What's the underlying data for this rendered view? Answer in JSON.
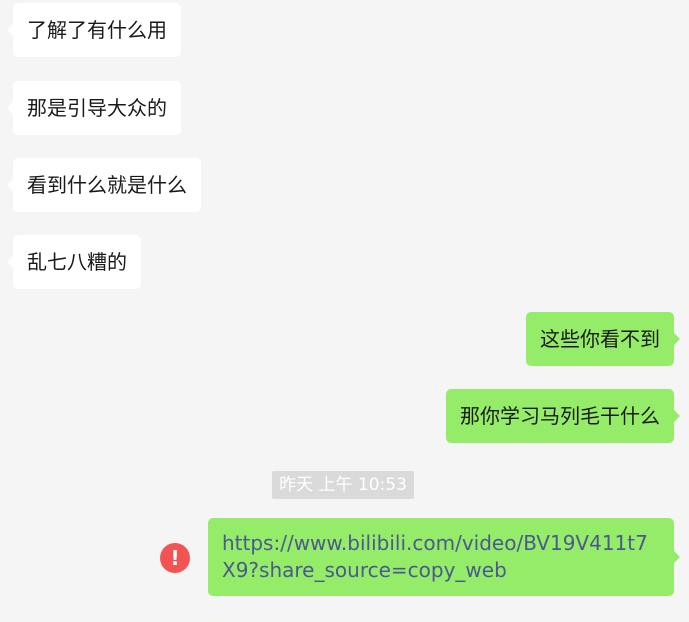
{
  "messages": [
    {
      "direction": "incoming",
      "text": "了解了有什么用"
    },
    {
      "direction": "incoming",
      "text": "那是引导大众的"
    },
    {
      "direction": "incoming",
      "text": "看到什么就是什么"
    },
    {
      "direction": "incoming",
      "text": "乱七八糟的"
    },
    {
      "direction": "outgoing",
      "text": "这些你看不到"
    },
    {
      "direction": "outgoing",
      "text": "那你学习马列毛干什么"
    },
    {
      "direction": "outgoing",
      "text": "https://www.bilibili.com/video/BV19V411t7X9?share_source=copy_web",
      "status": "failed"
    }
  ],
  "timestamp": "昨天 上午 10:53",
  "icons": {
    "send_failed": "exclamation-icon"
  },
  "colors": {
    "background": "#f5f5f5",
    "incoming_bubble": "#ffffff",
    "outgoing_bubble": "#95ec69",
    "link_text": "#4a5a8c",
    "error": "#f25454",
    "timestamp_bg": "#dadada"
  }
}
